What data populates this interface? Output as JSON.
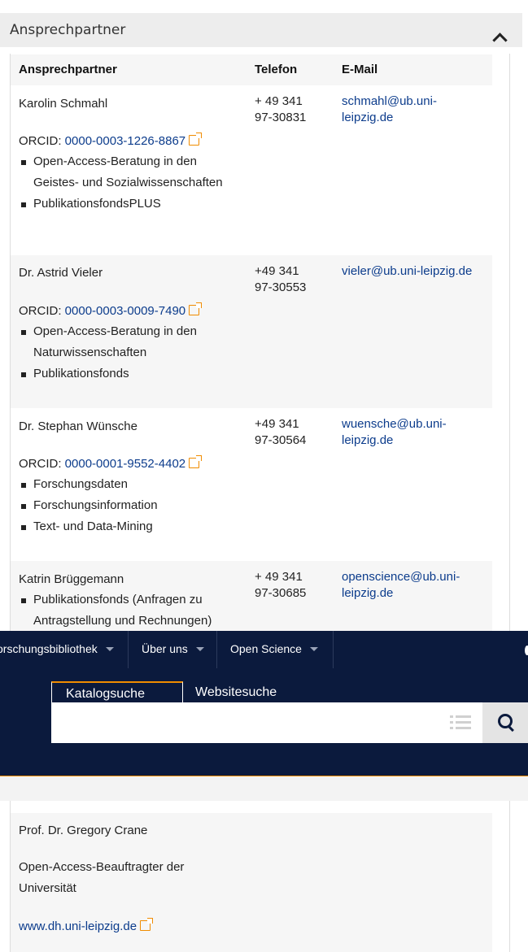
{
  "accordion": {
    "title": "Ansprechpartner"
  },
  "table": {
    "headers": {
      "contact": "Ansprechpartner",
      "phone": "Telefon",
      "email": "E-Mail"
    },
    "rows": [
      {
        "name": "Karolin Schmahl",
        "orcid_label": "ORCID:",
        "orcid": "0000-0003-1226-8867",
        "topics": [
          "Open-Access-Beratung in den Geistes- und Sozialwissenschaften",
          "PublikationsfondsPLUS"
        ],
        "phone": [
          "+ 49 341",
          "97-30831"
        ],
        "email": [
          "schmahl@ub.uni-",
          "leipzig.de"
        ]
      },
      {
        "name": "Dr. Astrid Vieler",
        "orcid_label": "ORCID:",
        "orcid": "0000-0003-0009-7490",
        "topics": [
          "Open-Access-Beratung in den Naturwissenschaften",
          "Publikationsfonds"
        ],
        "phone": [
          "+49 341",
          "97-30553"
        ],
        "email": [
          "vieler@ub.uni-leipzig.de"
        ]
      },
      {
        "name": "Dr. Stephan Wünsche",
        "orcid_label": "ORCID:",
        "orcid": "0000-0001-9552-4402",
        "topics": [
          "Forschungsdaten",
          "Forschungsinformation",
          "Text- und Data-Mining"
        ],
        "phone": [
          "+49 341",
          "97-30564"
        ],
        "email": [
          "wuensche@ub.uni-",
          "leipzig.de"
        ]
      },
      {
        "name": "Katrin Brüggemann",
        "topics": [
          "Publikationsfonds (Anfragen zu Antragstellung und Rechnungen)"
        ],
        "phone": [
          "+ 49 341",
          "97-30685"
        ],
        "email": [
          "openscience@ub.uni-",
          "leipzig.de"
        ]
      }
    ]
  },
  "nav": {
    "items": [
      "orschungsbibliothek",
      "Über uns",
      "Open Science"
    ],
    "tabs": [
      "Katalogsuche",
      "Websitesuche"
    ],
    "search": {
      "value": ""
    }
  },
  "last_contact": {
    "name": "Prof. Dr. Gregory Crane",
    "role": "Open-Access-Beauftragter der Universität",
    "link": "www.dh.uni-leipzig.de"
  },
  "colors": {
    "accent": "#f08c00",
    "nav_bg": "#0b1a3d",
    "link": "#0c3c8c"
  }
}
